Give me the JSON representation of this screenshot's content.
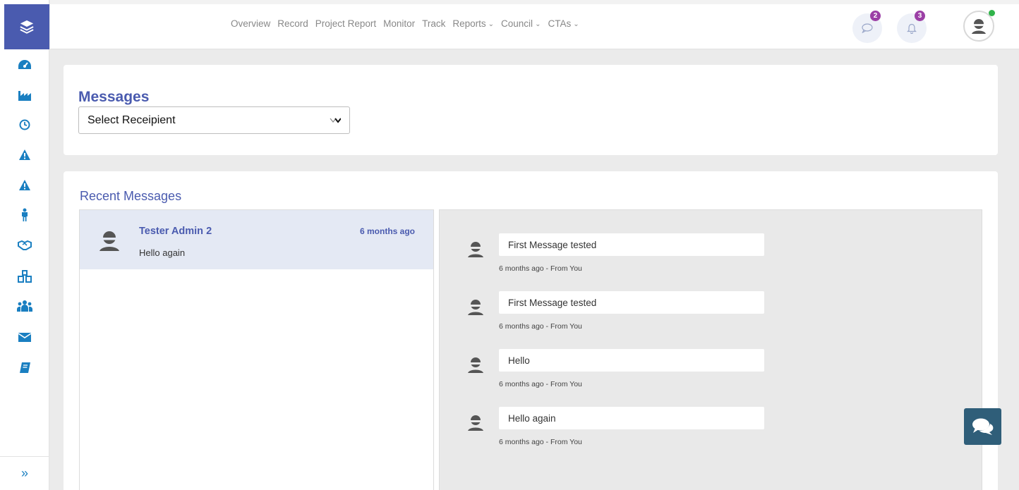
{
  "sidebar": {
    "items": [
      {
        "icon": "tachometer-icon"
      },
      {
        "icon": "industry-icon"
      },
      {
        "icon": "clock-icon"
      },
      {
        "icon": "warning-icon"
      },
      {
        "icon": "warning-icon"
      },
      {
        "icon": "person-icon"
      },
      {
        "icon": "handshake-icon"
      },
      {
        "icon": "cubes-icon"
      },
      {
        "icon": "users-icon"
      },
      {
        "icon": "envelope-icon"
      },
      {
        "icon": "book-icon"
      }
    ],
    "toggle": "»"
  },
  "topnav": {
    "items": [
      {
        "label": "Overview"
      },
      {
        "label": "Record"
      },
      {
        "label": "Project Report"
      },
      {
        "label": "Monitor"
      },
      {
        "label": "Track"
      },
      {
        "label": "Reports",
        "dropdown": true
      },
      {
        "label": "Council",
        "dropdown": true
      },
      {
        "label": "CTAs",
        "dropdown": true
      }
    ],
    "messages_badge": "2",
    "notifications_badge": "3"
  },
  "messages": {
    "title": "Messages",
    "select_value": "Select Receipient"
  },
  "recent": {
    "title": "Recent Messages",
    "conversations": [
      {
        "name": "Tester Admin 2",
        "time": "6 months ago",
        "preview": "Hello again"
      }
    ],
    "thread": [
      {
        "text": "First Message tested",
        "meta": "6 months ago - From You"
      },
      {
        "text": "First Message tested",
        "meta": "6 months ago - From You"
      },
      {
        "text": "Hello",
        "meta": "6 months ago - From You"
      },
      {
        "text": "Hello again",
        "meta": "6 months ago - From You"
      }
    ]
  },
  "colors": {
    "accent": "#4a5baf",
    "sidebar_icon": "#1a7fc1",
    "badge": "#9b3fa5",
    "online": "#30b34a",
    "chat_fab": "#2f5e79"
  }
}
